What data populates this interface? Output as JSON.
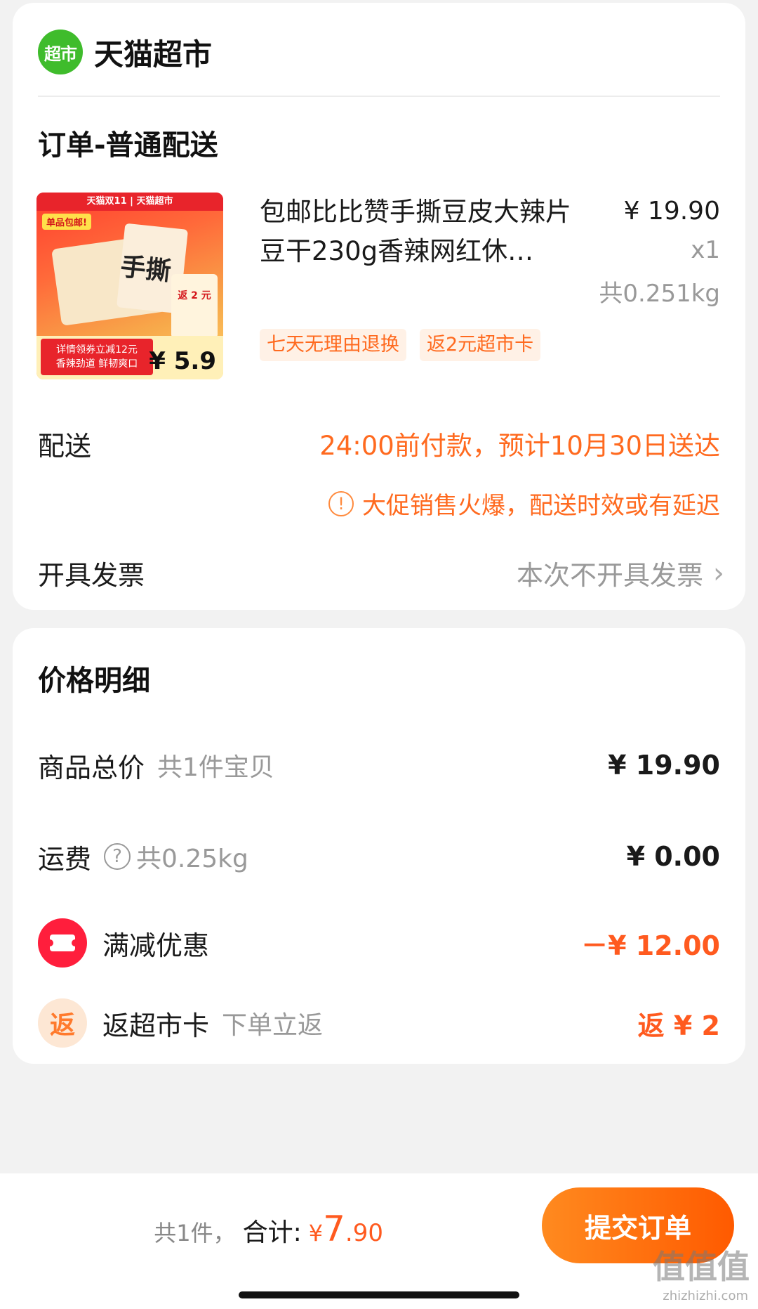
{
  "store": {
    "logo_text": "超市",
    "name": "天猫超市"
  },
  "order": {
    "section_title": "订单-普通配送",
    "product": {
      "image": {
        "top_banner": "天猫双11 | 天猫超市",
        "badge": "单品包邮!",
        "pack_text": "手撕",
        "panel_text": "返 2 元",
        "bottom_text_1": "详情领券立减12元",
        "bottom_text_2": "香辣劲道 鲜韧爽口",
        "price": "¥ 5.9"
      },
      "title": "包邮比比赞手撕豆皮大辣片豆干230g香辣网红休…",
      "price": "¥ 19.90",
      "qty": "x1",
      "weight": "共0.251kg",
      "tags": [
        "七天无理由退换",
        "返2元超市卡"
      ]
    },
    "delivery": {
      "label": "配送",
      "value": "24:00前付款，预计10月30日送达",
      "warning": "大促销售火爆，配送时效或有延迟"
    },
    "invoice": {
      "label": "开具发票",
      "value": "本次不开具发票"
    }
  },
  "price_detail": {
    "title": "价格明细",
    "total": {
      "label": "商品总价",
      "sub": "共1件宝贝",
      "value": "¥ 19.90"
    },
    "shipping": {
      "label": "运费",
      "sub": "共0.25kg",
      "value": "¥ 0.00"
    },
    "discount": {
      "label": "满减优惠",
      "value": "－¥ 12.00"
    },
    "cashback": {
      "icon_text": "返",
      "label": "返超市卡",
      "sub": "下单立返",
      "value": "返 ¥ 2"
    }
  },
  "bottom": {
    "count": "共1件，",
    "total_label": "合计:",
    "currency": "¥",
    "amount": "7",
    "cents": ".90",
    "submit_label": "提交订单"
  },
  "watermark": {
    "text": "值值值",
    "sub": "zhizhizhi.com"
  },
  "colors": {
    "accent": "#ff6a1f",
    "store_green": "#3fbc2c",
    "discount_red": "#ff1e3c"
  }
}
